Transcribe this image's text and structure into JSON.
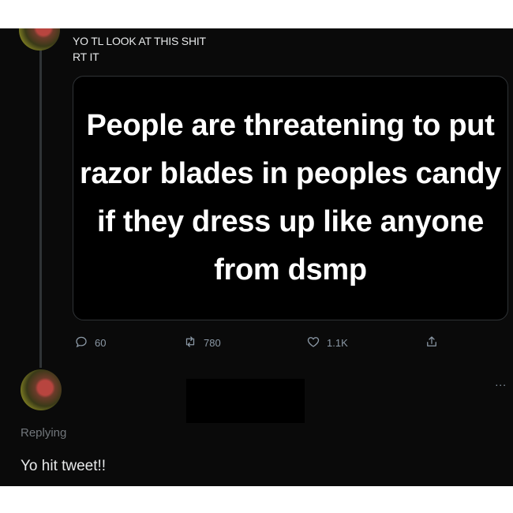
{
  "tweet": {
    "text_line_1": "YO TL LOOK AT THIS SHIT",
    "text_line_2": "RT IT",
    "image_text": "People are threatening to put razor blades in peoples candy if they dress up like anyone from dsmp",
    "actions": {
      "replies": "60",
      "retweets": "780",
      "likes": "1.1K"
    },
    "icons": [
      "reply-icon",
      "retweet-icon",
      "like-icon",
      "share-icon"
    ]
  },
  "reply": {
    "replying_label": "Replying",
    "text": "Yo hit tweet!!",
    "more_label": "..."
  },
  "colors": {
    "background": "#0a0a0a",
    "primary_text": "#e7e9ea",
    "secondary_text": "#8b98a5",
    "border": "#2f3336"
  }
}
